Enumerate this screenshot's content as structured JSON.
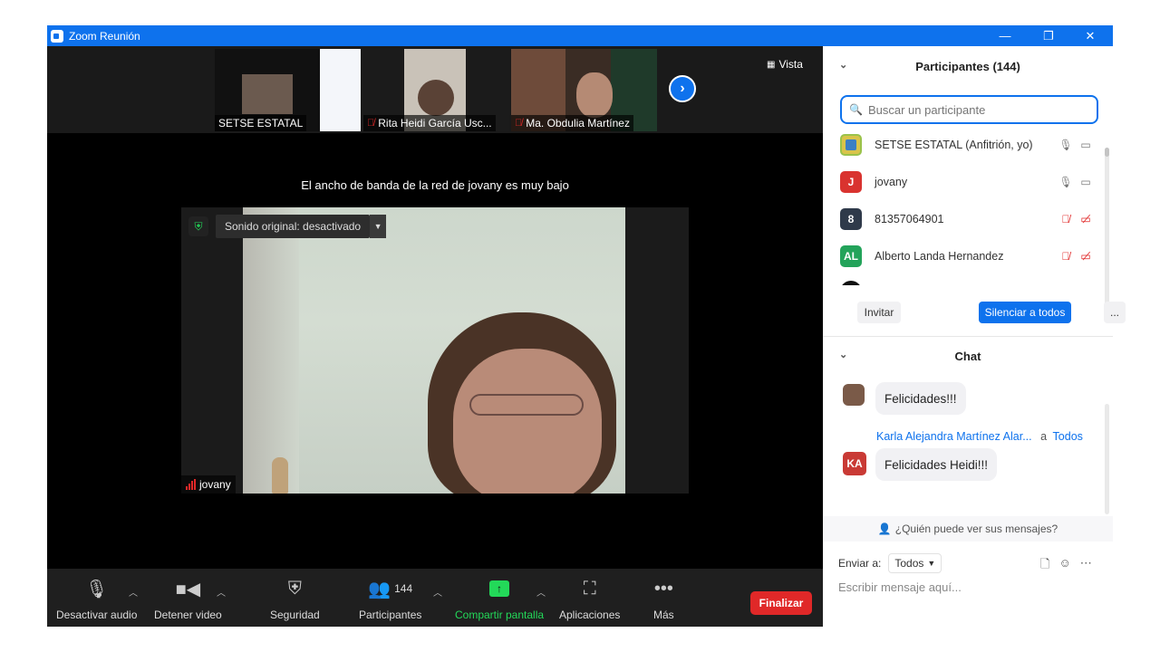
{
  "window": {
    "title": "Zoom Reunión",
    "minimize": "—",
    "restore": "❐",
    "close": "✕"
  },
  "thumbnails": [
    {
      "name": "SETSE ESTATAL",
      "muted": false
    },
    {
      "name": "Rita Heidi García Usc...",
      "muted": true
    },
    {
      "name": "Ma. Obdulia Martínez",
      "muted": true
    }
  ],
  "view_button": "Vista",
  "bandwidth_notice": "El ancho de banda de la red de jovany es muy bajo",
  "active_video": {
    "sound_label": "Sonido original: desactivado",
    "speaker_name": "jovany"
  },
  "toolbar": {
    "audio": "Desactivar audio",
    "video": "Detener video",
    "security": "Seguridad",
    "participants": "Participantes",
    "participants_count": "144",
    "share": "Compartir pantalla",
    "apps": "Aplicaciones",
    "more": "Más",
    "end": "Finalizar"
  },
  "participants_panel": {
    "title": "Participantes (144)",
    "search_placeholder": "Buscar un participante",
    "items": [
      {
        "initials": "",
        "name": "SETSE ESTATAL (Anfitrión, yo)",
        "color": "#d9c44a",
        "muted": false
      },
      {
        "initials": "J",
        "name": "jovany",
        "color": "#d9332f",
        "muted": false
      },
      {
        "initials": "8",
        "name": "81357064901",
        "color": "#2f3a4a",
        "muted": true
      },
      {
        "initials": "AL",
        "name": "Alberto Landa Hernandez",
        "color": "#23a35a",
        "muted": true
      }
    ],
    "invite": "Invitar",
    "mute_all": "Silenciar a todos",
    "more": "..."
  },
  "chat": {
    "title": "Chat",
    "messages": [
      {
        "sender": "",
        "recipient": "",
        "initials": "",
        "text": "Felicidades!!!"
      },
      {
        "sender": "Karla Alejandra Martínez Alar...",
        "recipient_prefix": "a",
        "recipient": "Todos",
        "initials": "KA",
        "text": "Felicidades Heidi!!!"
      }
    ],
    "who_can_see": "¿Quién puede ver sus mensajes?",
    "send_to_label": "Enviar a:",
    "send_to_value": "Todos",
    "composer_placeholder": "Escribir mensaje aquí..."
  },
  "colors": {
    "accent": "#0e72ed",
    "share_green": "#23d959",
    "end_red": "#e02828"
  }
}
